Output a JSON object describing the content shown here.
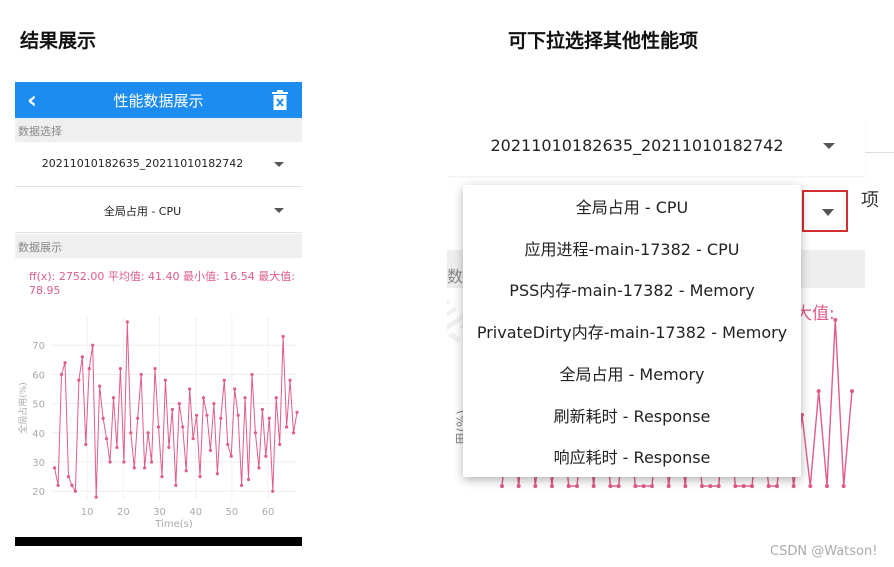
{
  "captions": {
    "left": "结果展示",
    "right": "可下拉选择其他性能项"
  },
  "phone": {
    "header_title": "性能数据展示",
    "section_select": "数据选择",
    "file_select": "20211010182635_20211010182742",
    "metric_select": "全局占用 - CPU",
    "section_display": "数据展示",
    "stats_text": "ff(x): 2752.00 平均值: 41.40 最小值: 16.54 最大值: 78.95",
    "colors": {
      "header": "#1d8cf0",
      "series": "#e05c8a"
    }
  },
  "zoom": {
    "file_select": "20211010182635_20211010182742",
    "edge_char": "项",
    "band_char": "数",
    "pink_partial": "大值:",
    "y_tick": "50",
    "y_label_partial": "用(%)"
  },
  "dropdown": {
    "options": [
      "全局占用 - CPU",
      "应用进程-main-17382 - CPU",
      "PSS内存-main-17382 - Memory",
      "PrivateDirty内存-main-17382 - Memory",
      "全局占用 - Memory",
      "刷新耗时 - Response",
      "响应耗时 - Response"
    ]
  },
  "chart_data": {
    "type": "line",
    "xlabel": "Time(s)",
    "ylabel": "全局占用(%)",
    "xlim": [
      0,
      68
    ],
    "ylim": [
      17,
      80
    ],
    "x_ticks": [
      10,
      20,
      30,
      40,
      50,
      60
    ],
    "y_ticks": [
      20,
      30,
      40,
      50,
      60,
      70
    ],
    "series": [
      {
        "values": [
          28,
          22,
          60,
          64,
          25,
          22,
          20,
          58,
          66,
          36,
          62,
          70,
          18,
          56,
          45,
          38,
          30,
          52,
          35,
          62,
          30,
          78,
          40,
          28,
          45,
          60,
          28,
          40,
          30,
          62,
          42,
          25,
          58,
          35,
          48,
          22,
          50,
          42,
          27,
          55,
          38,
          46,
          25,
          52,
          46,
          34,
          50,
          26,
          45,
          58,
          36,
          32,
          55,
          46,
          22,
          52,
          24,
          60,
          40,
          28,
          48,
          32,
          45,
          20,
          52,
          36,
          73,
          42,
          58,
          40,
          47
        ]
      }
    ]
  },
  "zoom_chart_data": {
    "type": "line",
    "values": [
      20,
      55,
      20,
      60,
      20,
      50,
      20,
      58,
      20,
      20,
      55,
      20,
      62,
      20,
      20,
      58,
      20,
      20,
      20,
      58,
      20,
      50,
      20,
      60,
      20,
      20,
      20,
      60,
      20,
      20,
      20,
      52,
      20,
      20,
      52,
      20,
      50,
      20,
      60,
      20,
      90,
      20,
      60
    ]
  },
  "watermark": "CSDN @Watson!"
}
